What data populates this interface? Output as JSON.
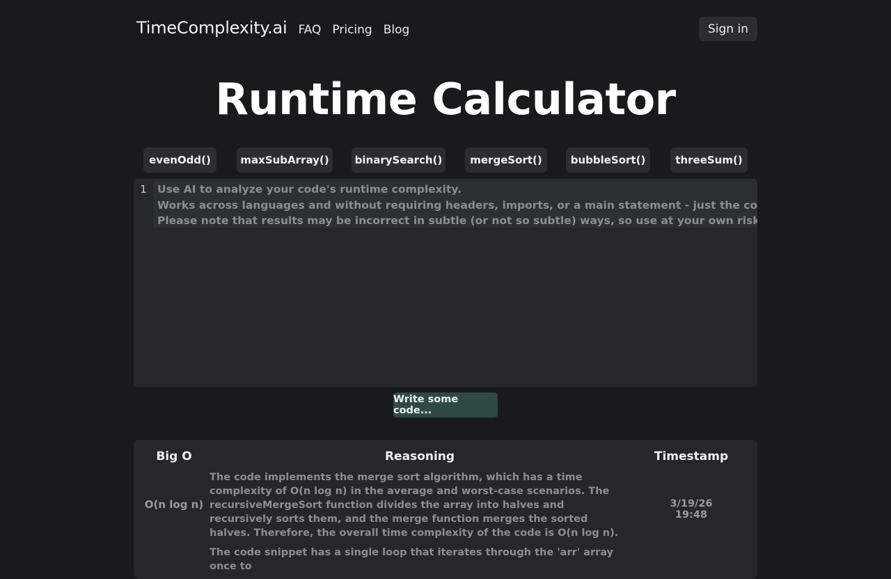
{
  "nav": {
    "brand": "TimeComplexity.ai",
    "links": [
      "FAQ",
      "Pricing",
      "Blog"
    ],
    "signin": "Sign in"
  },
  "title": "Runtime Calculator",
  "examples": [
    "evenOdd()",
    "maxSubArray()",
    "binarySearch()",
    "mergeSort()",
    "bubbleSort()",
    "threeSum()"
  ],
  "editor": {
    "line_number": "1",
    "placeholder_lines": [
      "Use AI to analyze your code's runtime complexity.",
      "Works across languages and without requiring headers, imports, or a main statement - just the code itself.",
      "Please note that results may be incorrect in subtle (or not so subtle) ways, so use at your own risk!"
    ]
  },
  "submit_label": "Write some code...",
  "results": {
    "headers": [
      "Big O",
      "Reasoning",
      "Timestamp"
    ],
    "rows": [
      {
        "big_o": "O(n log n)",
        "reasoning": "The code implements the merge sort algorithm, which has a time complexity of O(n log n) in the average and worst-case scenarios. The recursiveMergeSort function divides the array into halves and recursively sorts them, and the merge function merges the sorted halves. Therefore, the overall time complexity of the code is O(n log n).",
        "timestamp": "3/19/26 19:48"
      },
      {
        "big_o": "",
        "reasoning": "The code snippet has a single loop that iterates through the 'arr' array once to",
        "timestamp": ""
      }
    ]
  }
}
